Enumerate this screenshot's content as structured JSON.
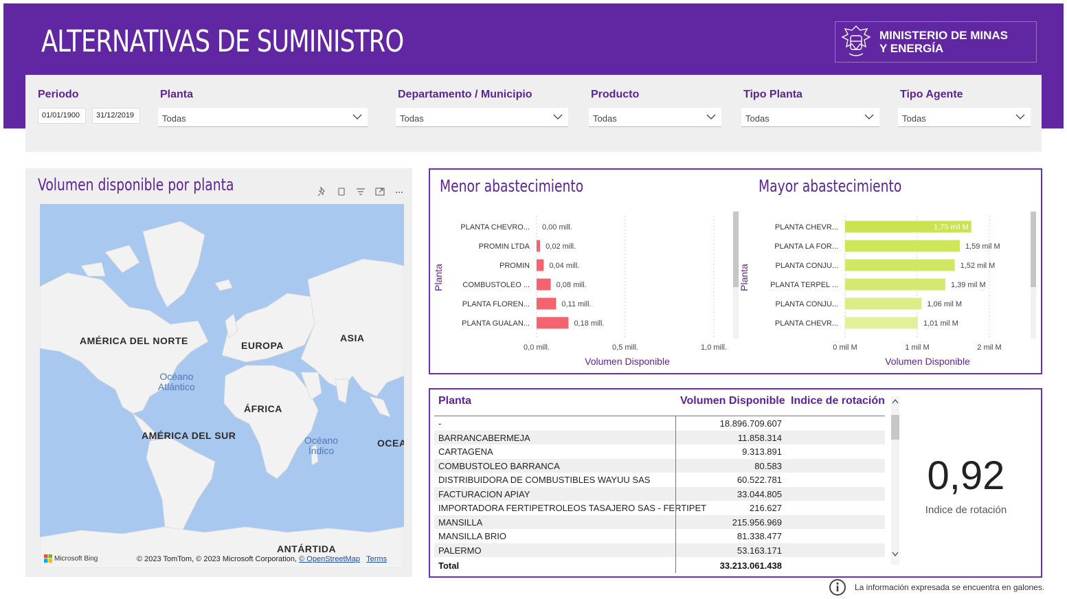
{
  "header": {
    "title": "ALTERNATIVAS DE SUMINISTRO",
    "logo_line1": "MINISTERIO DE MINAS",
    "logo_line2": "Y ENERGÍA",
    "background": "#6126a1"
  },
  "filters": {
    "periodo": {
      "label": "Periodo",
      "start": "01/01/1900",
      "end": "31/12/2019"
    },
    "planta": {
      "label": "Planta",
      "value": "Todas"
    },
    "departamento": {
      "label": "Departamento / Municipio",
      "value": "Todas"
    },
    "producto": {
      "label": "Producto",
      "value": "Todas"
    },
    "tipo_planta": {
      "label": "Tipo Planta",
      "value": "Todas"
    },
    "tipo_agente": {
      "label": "Tipo Agente",
      "value": "Todas"
    }
  },
  "map": {
    "title": "Volumen disponible por planta",
    "toolbar_icons": [
      "pin-icon",
      "copy-icon",
      "filter-icon",
      "focus-mode-icon",
      "more-options-icon"
    ],
    "labels": {
      "north_america": "AMÉRICA DEL NORTE",
      "europe": "EUROPA",
      "asia": "ASIA",
      "africa": "ÁFRICA",
      "south_america": "AMÉRICA DEL SUR",
      "antarctica": "ANTÁRTIDA",
      "oceania": "OCEA",
      "atlantic_1": "Océano",
      "atlantic_2": "Atlántico",
      "indian_1": "Océano",
      "indian_2": "Índico"
    },
    "bing": "Microsoft Bing",
    "credit_text": "© 2023 TomTom, © 2023 Microsoft Corporation,",
    "credit_osm": "© OpenStreetMap",
    "credit_terms": "Terms"
  },
  "chart_data": [
    {
      "type": "bar",
      "orientation": "horizontal",
      "title": "Menor abastecimiento",
      "ylabel": "Planta",
      "xlabel": "Volumen Disponible",
      "categories": [
        "PLANTA CHEVRO...",
        "PROMIN LTDA",
        "PROMIN",
        "COMBUSTOLEO ...",
        "PLANTA FLOREN...",
        "PLANTA GUALAN..."
      ],
      "values": [
        0.0,
        0.02,
        0.04,
        0.08,
        0.11,
        0.18
      ],
      "data_labels": [
        "0,00 mill.",
        "0,02 mill.",
        "0,04 mill.",
        "0,08 mill.",
        "0,11 mill.",
        "0,18 mill."
      ],
      "xlim": [
        0,
        1.0
      ],
      "xticks": [
        0,
        0.5,
        1.0
      ],
      "xtick_labels": [
        "0,0 mill.",
        "0,5 mill.",
        "1,0 mill."
      ],
      "color": "#f4646e"
    },
    {
      "type": "bar",
      "orientation": "horizontal",
      "title": "Mayor abastecimiento",
      "ylabel": "Planta",
      "xlabel": "Volumen Disponible",
      "categories": [
        "PLANTA CHEVR...",
        "PLANTA LA FOR...",
        "PLANTA CONJU...",
        "PLANTA TERPEL ...",
        "PLANTA CONJU...",
        "PLANTA CHEVR..."
      ],
      "values": [
        1.75,
        1.59,
        1.52,
        1.39,
        1.06,
        1.01
      ],
      "data_labels": [
        "1,75 mil M",
        "1,59 mil M",
        "1,52 mil M",
        "1,39 mil M",
        "1,06 mil M",
        "1,01 mil M"
      ],
      "xlim": [
        0,
        2
      ],
      "xticks": [
        0,
        1,
        2
      ],
      "xtick_labels": [
        "0 mil M",
        "1 mil M",
        "2 mil M"
      ],
      "colors": [
        "#c9e44e",
        "#cde65a",
        "#d0e763",
        "#d5e972",
        "#dbed88",
        "#e1f09b"
      ]
    }
  ],
  "table": {
    "headers": {
      "planta": "Planta",
      "volumen": "Volumen Disponible",
      "indice": "Indice de rotación"
    },
    "rows": [
      {
        "planta": "-",
        "volumen": "18.896.709.607"
      },
      {
        "planta": "BARRANCABERMEJA",
        "volumen": "11.858.314"
      },
      {
        "planta": "CARTAGENA",
        "volumen": "9.313.891"
      },
      {
        "planta": "COMBUSTOLEO BARRANCA",
        "volumen": "80.583"
      },
      {
        "planta": "DISTRIBUIDORA DE COMBUSTIBLES WAYUU SAS",
        "volumen": "60.522.781"
      },
      {
        "planta": "FACTURACION APIAY",
        "volumen": "33.044.805"
      },
      {
        "planta": "IMPORTADORA FERTIPETROLEOS TASAJERO SAS - FERTIPET",
        "volumen": "216.627"
      },
      {
        "planta": "MANSILLA",
        "volumen": "215.956.969"
      },
      {
        "planta": "MANSILLA BRIO",
        "volumen": "81.338.477"
      },
      {
        "planta": "PALERMO",
        "volumen": "53.163.171"
      }
    ],
    "total_label": "Total",
    "total_value": "33.213.061.438"
  },
  "kpi": {
    "value": "0,92",
    "label": "Indice de rotación"
  },
  "footer": {
    "note": "La información expresada se encuentra en galones."
  }
}
